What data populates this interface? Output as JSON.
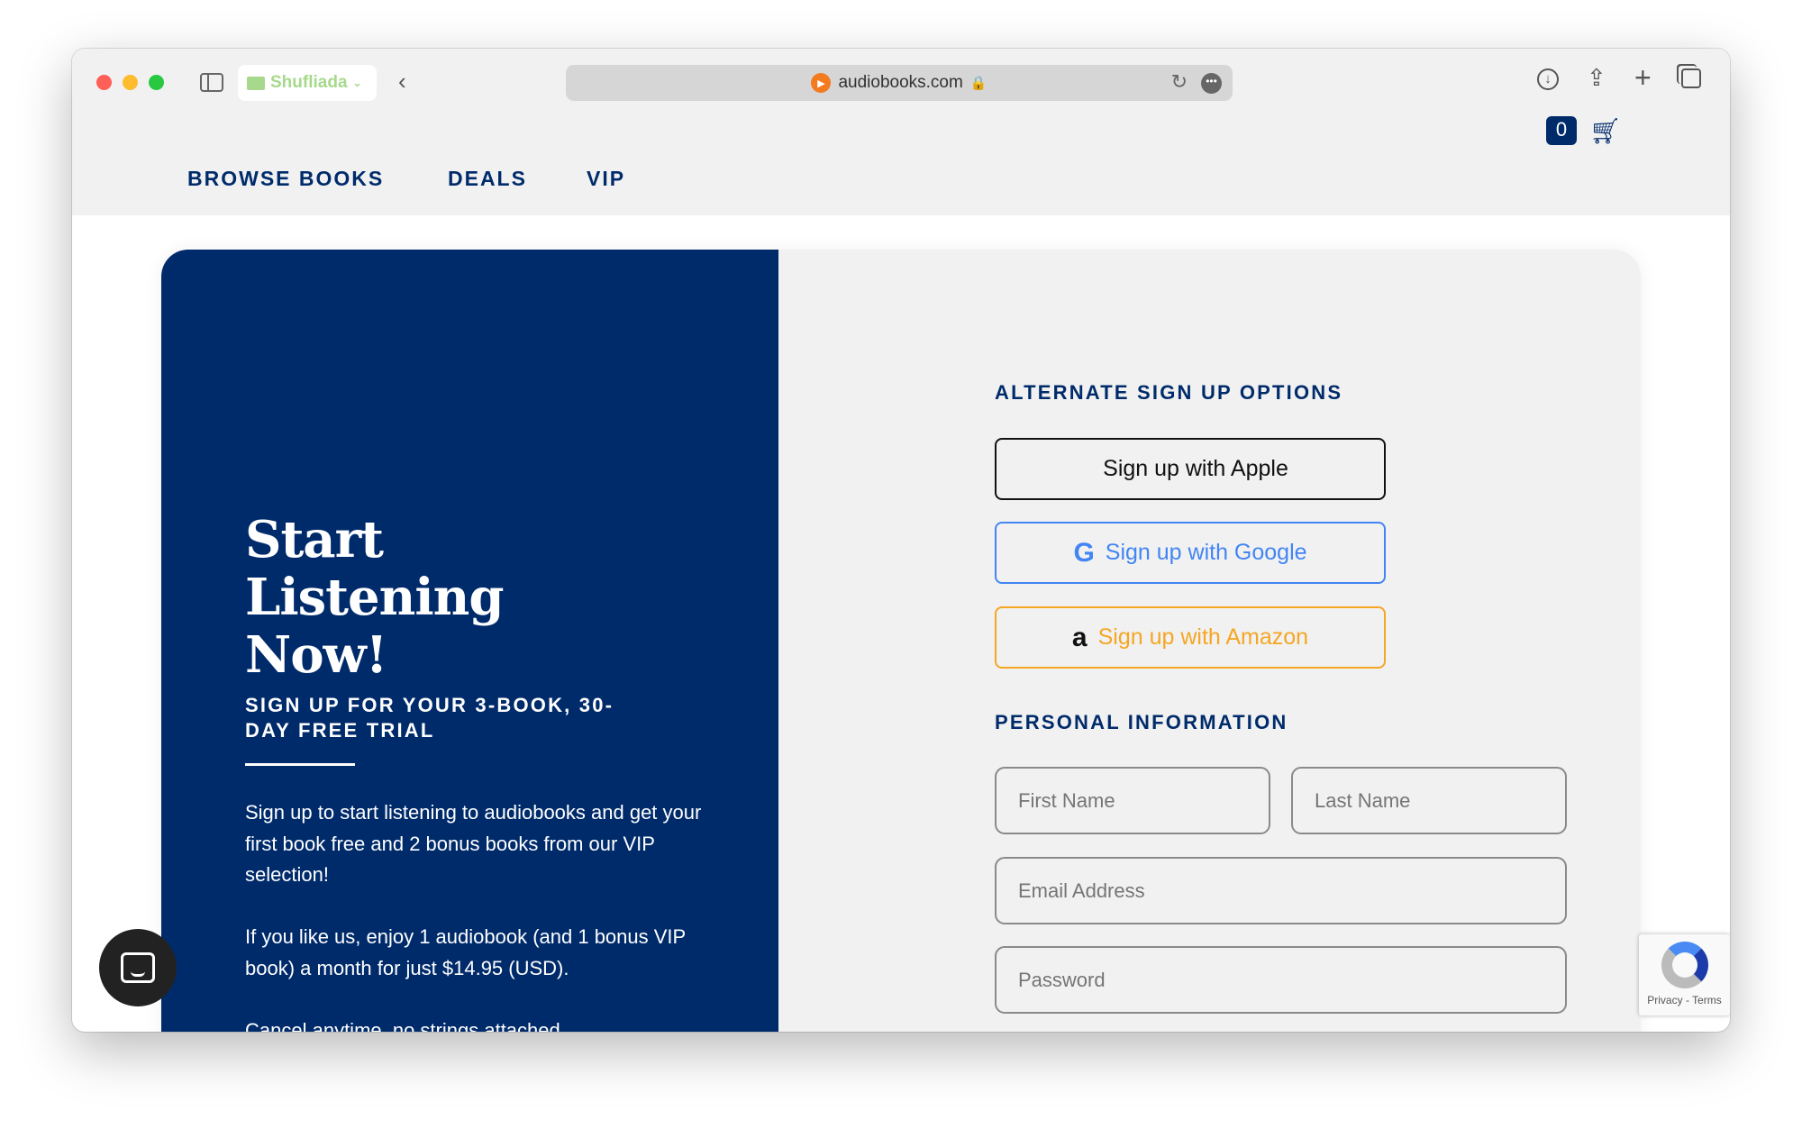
{
  "browser": {
    "profile": "Shufliada",
    "url": "audiobooks.com"
  },
  "nav": {
    "items": [
      "BROWSE BOOKS",
      "DEALS",
      "VIP"
    ],
    "cart_count": "0"
  },
  "hero": {
    "title": "Start Listening Now!",
    "subtitle": "SIGN UP FOR YOUR 3-BOOK, 30-DAY FREE TRIAL",
    "paragraphs": [
      "Sign up to start listening to audiobooks and get your first book free and 2 bonus books from our VIP selection!",
      "If you like us, enjoy 1 audiobook (and 1 bonus VIP book) a month for just $14.95 (USD).",
      "Cancel anytime, no strings attached."
    ]
  },
  "form": {
    "alt_heading": "ALTERNATE SIGN UP OPTIONS",
    "apple": "Sign up with Apple",
    "google": "Sign up with Google",
    "amazon": "Sign up with Amazon",
    "personal_heading": "PERSONAL INFORMATION",
    "first_name": "First Name",
    "last_name": "Last Name",
    "email": "Email Address",
    "password": "Password"
  },
  "recaptcha": {
    "text": "Privacy - Terms"
  },
  "colors": {
    "brand": "#002b6b",
    "google": "#4285f4",
    "amazon": "#f5a623"
  }
}
